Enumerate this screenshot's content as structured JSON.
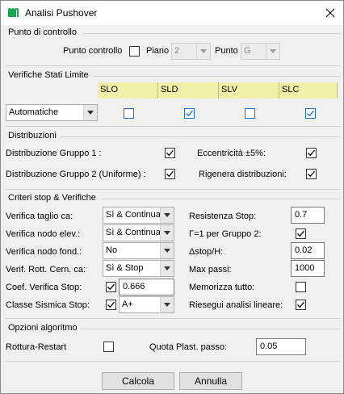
{
  "window": {
    "title": "Analisi Pushover",
    "close_icon": "close-icon"
  },
  "punto_controllo": {
    "group_title": "Punto di controllo",
    "label": "Punto controllo",
    "checked": false,
    "piano_label": "Piano",
    "piano_value": "2",
    "punto_label": "Punto",
    "punto_value": "G"
  },
  "verifiche": {
    "group_title": "Verifiche Stati Limite",
    "columns": [
      "SLO",
      "SLD",
      "SLV",
      "SLC"
    ],
    "mode_value": "Automatiche",
    "checks": [
      false,
      true,
      false,
      true
    ]
  },
  "distribuzioni": {
    "group_title": "Distribuzioni",
    "gruppo1_label": "Distribuzione Gruppo 1 :",
    "gruppo1_checked": true,
    "eccentricita_label": "Eccentricità ±5%:",
    "eccentricita_checked": true,
    "gruppo2_label": "Distribuzione Gruppo 2 (Uniforme) :",
    "gruppo2_checked": true,
    "rigenera_label": "Rigenera distribuzioni:",
    "rigenera_checked": true
  },
  "criteri": {
    "group_title": "Criteri stop & Verifiche",
    "taglio_label": "Verifica taglio ca:",
    "taglio_value": "Sì & Continua",
    "nodo_elev_label": "Verifica nodo elev.:",
    "nodo_elev_value": "Sì & Continua",
    "nodo_fond_label": "Verifica nodo fond.:",
    "nodo_fond_value": "No",
    "rott_label": "Verif. Rott. Cern. ca:",
    "rott_value": "Sì & Stop",
    "coef_label": "Coef. Verifica Stop:",
    "coef_checked": true,
    "coef_value": "0.666",
    "classe_label": "Classe Sismica Stop:",
    "classe_checked": true,
    "classe_value": "A+",
    "resistenza_label": "Resistenza Stop:",
    "resistenza_value": "0.7",
    "gamma_label": "Γ=1 per Gruppo 2:",
    "gamma_checked": true,
    "dstop_label": "Δstop/H:",
    "dstop_value": "0.02",
    "maxpassi_label": "Max passi:",
    "maxpassi_value": "1000",
    "memorizza_label": "Memorizza tutto:",
    "memorizza_checked": false,
    "riesegui_label": "Riesegui analisi lineare:",
    "riesegui_checked": true
  },
  "opzioni": {
    "group_title": "Opzioni algoritmo",
    "rottura_label": "Rottura-Restart",
    "rottura_checked": false,
    "quota_label": "Quota Plast. passo:",
    "quota_value": "0.05"
  },
  "buttons": {
    "ok_label": "Calcola",
    "cancel_label": "Annulla"
  }
}
